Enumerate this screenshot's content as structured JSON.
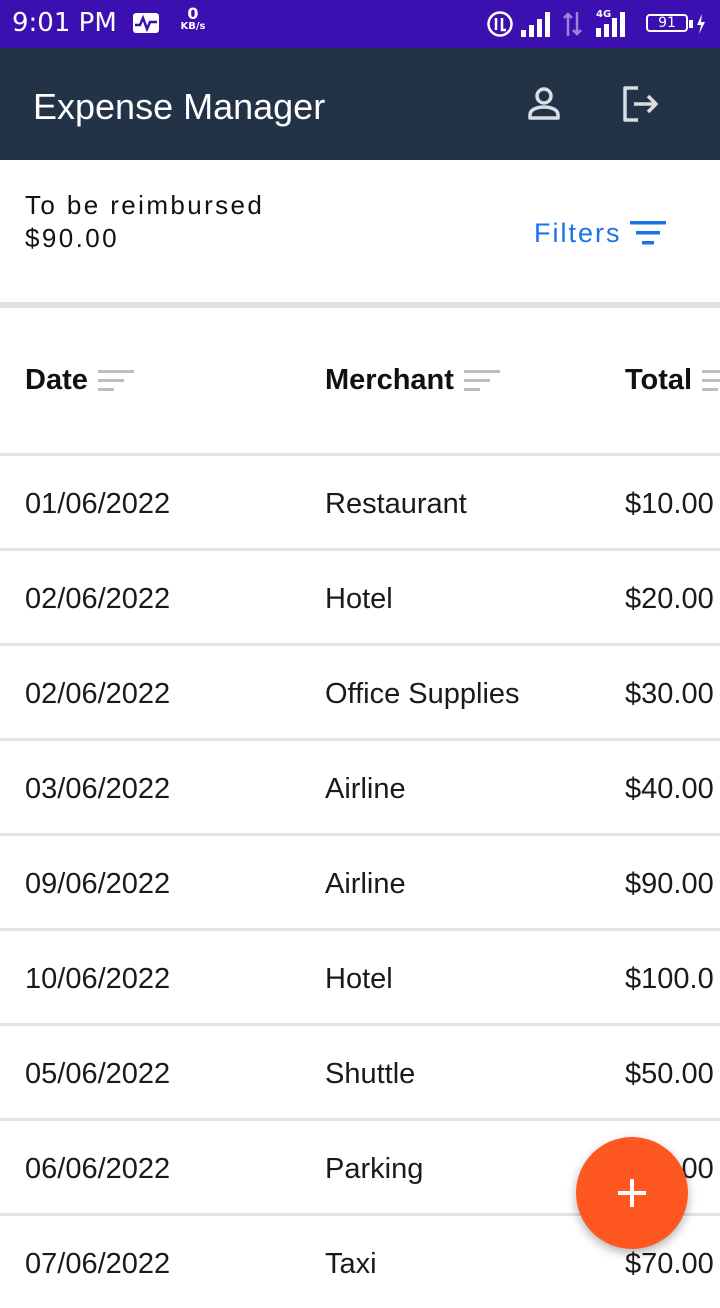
{
  "status_bar": {
    "time": "9:01 PM",
    "net_speed_value": "0",
    "net_speed_unit": "KB/s",
    "network_type": "4G",
    "battery_level": "91",
    "icons": [
      "activity-pulse-icon",
      "roaming-icon",
      "signal-strength-icon",
      "data-transfer-icon",
      "signal-4g-icon",
      "battery-charging-icon"
    ]
  },
  "app_bar": {
    "title": "Expense Manager",
    "background": "#223247",
    "icons": [
      "profile-icon",
      "logout-icon"
    ]
  },
  "summary": {
    "label": "To be reimbursed",
    "amount": "$90.00",
    "filters_label": "Filters",
    "accent": "#1a73e8"
  },
  "table": {
    "columns": [
      "Date",
      "Merchant",
      "Total"
    ],
    "rows": [
      {
        "date": "01/06/2022",
        "merchant": "Restaurant",
        "total": "$10.00"
      },
      {
        "date": "02/06/2022",
        "merchant": "Hotel",
        "total": "$20.00"
      },
      {
        "date": "02/06/2022",
        "merchant": "Office Supplies",
        "total": "$30.00"
      },
      {
        "date": "03/06/2022",
        "merchant": "Airline",
        "total": "$40.00"
      },
      {
        "date": "09/06/2022",
        "merchant": "Airline",
        "total": "$90.00"
      },
      {
        "date": "10/06/2022",
        "merchant": "Hotel",
        "total": "$100.0"
      },
      {
        "date": "05/06/2022",
        "merchant": "Shuttle",
        "total": "$50.00"
      },
      {
        "date": "06/06/2022",
        "merchant": "Parking",
        "total": "$60.00"
      },
      {
        "date": "07/06/2022",
        "merchant": "Taxi",
        "total": "$70.00"
      }
    ]
  },
  "fab": {
    "icon": "plus-icon",
    "color": "#ff5722"
  }
}
